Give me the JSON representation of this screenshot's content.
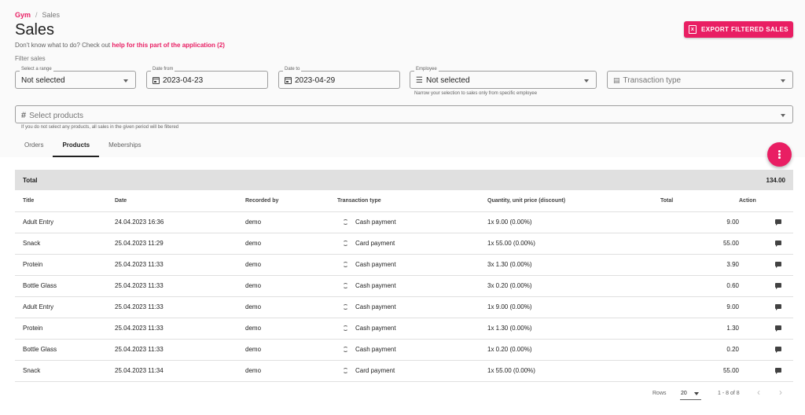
{
  "breadcrumb": {
    "root": "Gym",
    "separator": "/",
    "current": "Sales"
  },
  "page": {
    "title": "Sales",
    "help_prefix": "Don't know what to do? Check out ",
    "help_link": "help for this part of the application (2)",
    "filter_label": "Filter sales",
    "export_button": "EXPORT FILTERED SALES"
  },
  "filters": {
    "range": {
      "label": "Select a range",
      "value": "Not selected"
    },
    "date_from": {
      "label": "Date from",
      "value": "2023-04-23"
    },
    "date_to": {
      "label": "Date to",
      "value": "2023-04-29"
    },
    "employee": {
      "label": "Employee",
      "value": "Not selected",
      "hint": "Narrow your selection to sales only from specific employee"
    },
    "transaction_type": {
      "placeholder": "Transaction type"
    },
    "products": {
      "placeholder": "Select products",
      "hint": "If you do not select any products, all sales in the given period will be filtered"
    }
  },
  "tabs": [
    {
      "label": "Orders",
      "active": false
    },
    {
      "label": "Products",
      "active": true
    },
    {
      "label": "Meberships",
      "active": false
    }
  ],
  "totals": {
    "label": "Total",
    "value": "134.00"
  },
  "table": {
    "columns": [
      "Title",
      "Date",
      "Recorded by",
      "Transaction type",
      "Quantity, unit price (discount)",
      "Total",
      "Action"
    ],
    "rows": [
      [
        "Adult Entry",
        "24.04.2023 16:36",
        "demo",
        "Cash payment",
        "1x 9.00 (0.00%)",
        "9.00"
      ],
      [
        "Snack",
        "25.04.2023 11:29",
        "demo",
        "Card payment",
        "1x 55.00 (0.00%)",
        "55.00"
      ],
      [
        "Protein",
        "25.04.2023 11:33",
        "demo",
        "Cash payment",
        "3x 1.30 (0.00%)",
        "3.90"
      ],
      [
        "Bottle Glass",
        "25.04.2023 11:33",
        "demo",
        "Cash payment",
        "3x 0.20 (0.00%)",
        "0.60"
      ],
      [
        "Adult Entry",
        "25.04.2023 11:33",
        "demo",
        "Cash payment",
        "1x 9.00 (0.00%)",
        "9.00"
      ],
      [
        "Protein",
        "25.04.2023 11:33",
        "demo",
        "Cash payment",
        "1x 1.30 (0.00%)",
        "1.30"
      ],
      [
        "Bottle Glass",
        "25.04.2023 11:33",
        "demo",
        "Cash payment",
        "1x 0.20 (0.00%)",
        "0.20"
      ],
      [
        "Snack",
        "25.04.2023 11:34",
        "demo",
        "Card payment",
        "1x 55.00 (0.00%)",
        "55.00"
      ]
    ]
  },
  "pagination": {
    "rows_label": "Rows",
    "rows_value": "20",
    "range": "1 - 8 of 8",
    "prev": "‹",
    "next": "›"
  },
  "colors": {
    "accent": "#e91e63",
    "total_bar": "#e0e0e0"
  }
}
